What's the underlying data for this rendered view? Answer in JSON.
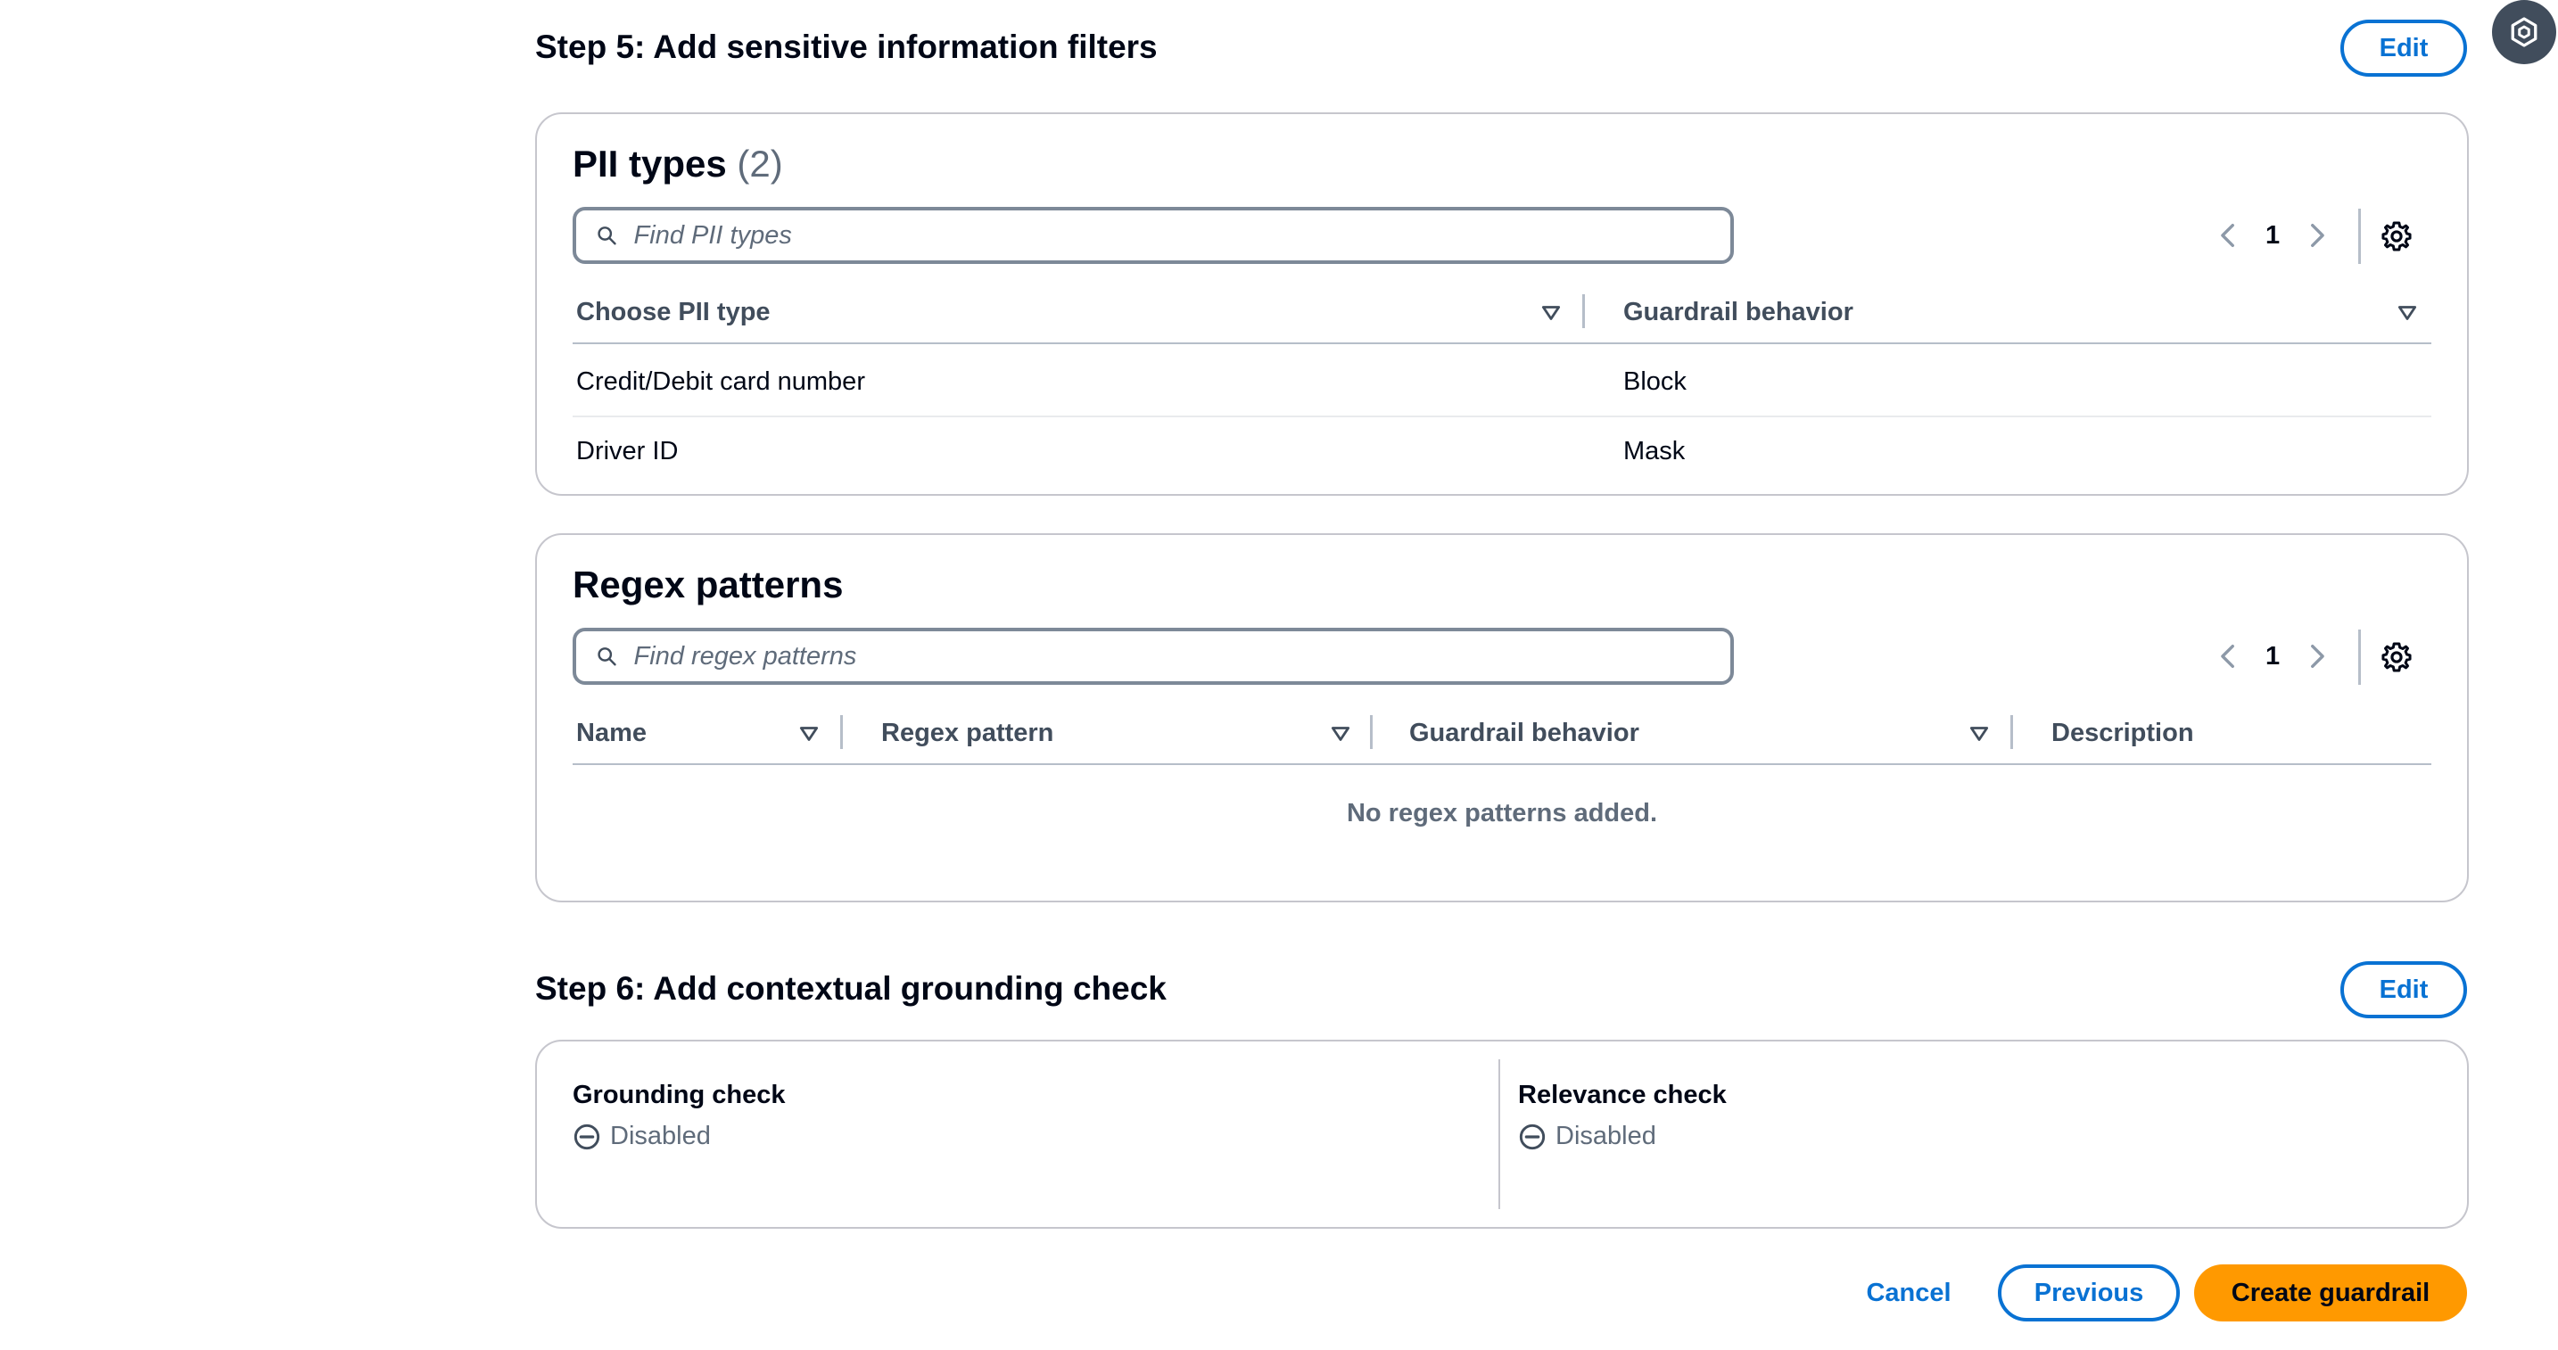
{
  "step5": {
    "title": "Step 5: Add sensitive information filters",
    "edit_label": "Edit",
    "pii": {
      "title": "PII types",
      "count": "(2)",
      "search_placeholder": "Find PII types",
      "page": "1",
      "columns": [
        "Choose PII type",
        "Guardrail behavior"
      ],
      "rows": [
        {
          "type": "Credit/Debit card number",
          "behavior": "Block"
        },
        {
          "type": "Driver ID",
          "behavior": "Mask"
        }
      ]
    },
    "regex": {
      "title": "Regex patterns",
      "search_placeholder": "Find regex patterns",
      "page": "1",
      "columns": [
        "Name",
        "Regex pattern",
        "Guardrail behavior",
        "Description"
      ],
      "empty_text": "No regex patterns added."
    }
  },
  "step6": {
    "title": "Step 6: Add contextual grounding check",
    "edit_label": "Edit",
    "grounding": {
      "label": "Grounding check",
      "status": "Disabled"
    },
    "relevance": {
      "label": "Relevance check",
      "status": "Disabled"
    }
  },
  "footer": {
    "cancel_label": "Cancel",
    "previous_label": "Previous",
    "create_label": "Create guardrail"
  },
  "colors": {
    "accent": "#0972d3",
    "primary_button": "#ff9900",
    "border": "#c6c6cd",
    "text": "#000716",
    "muted": "#5f6b7a"
  },
  "icons": {
    "search": "search-icon",
    "prev_page": "chevron-left-icon",
    "next_page": "chevron-right-icon",
    "settings": "gear-icon",
    "sort": "caret-down-icon",
    "status_disabled": "minus-circle-icon",
    "floating": "assistant-hexagon-icon"
  }
}
